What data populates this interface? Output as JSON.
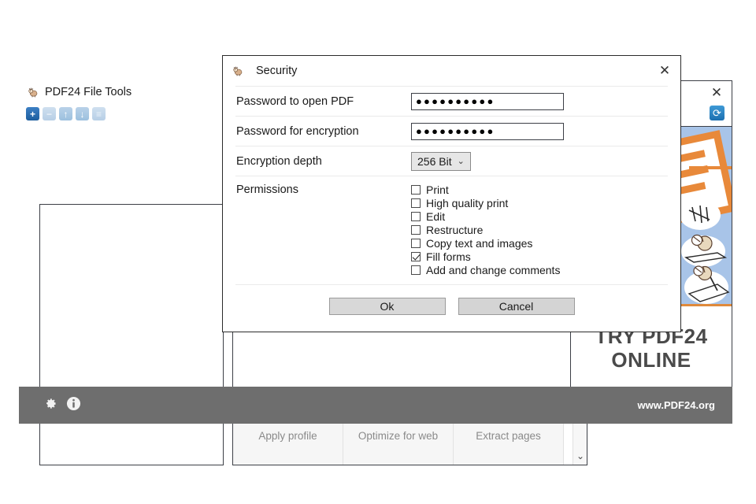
{
  "main_window": {
    "title": "PDF24 File Tools",
    "app_icon": "pdf24-sheep-icon",
    "toolbar": [
      {
        "name": "add-files-button",
        "glyph": "+",
        "state": "enabled"
      },
      {
        "name": "remove-files-button",
        "glyph": "−",
        "state": "disabled"
      },
      {
        "name": "move-up-button",
        "glyph": "↑",
        "state": "disabled"
      },
      {
        "name": "move-down-button",
        "glyph": "↓",
        "state": "disabled"
      },
      {
        "name": "sort-list-button",
        "glyph": "≡",
        "state": "disabled"
      }
    ],
    "file_list": {
      "items": [],
      "empty": true
    },
    "tools": [
      {
        "label": "Apply profile",
        "icon": "sliders-icon"
      },
      {
        "label": "Optimize for web",
        "icon": "web-optimize-icon"
      },
      {
        "label": "Extract pages",
        "icon": "extract-pages-icon"
      }
    ],
    "scroll_down_glyph": "⌄"
  },
  "ad_panel": {
    "close_glyph": "✕",
    "refresh_glyph": "⟳",
    "footer_line1": "TRY PDF24",
    "footer_line2": "ONLINE"
  },
  "status_bar": {
    "settings_icon": "gear-icon",
    "info_icon": "info-icon",
    "url": "www.PDF24.org",
    "background": "#6e6e6e"
  },
  "dialog": {
    "title": "Security",
    "icon": "pdf24-sheep-icon",
    "close_glyph": "✕",
    "fields": [
      {
        "label": "Password to open PDF",
        "value": "●●●●●●●●●●",
        "placeholder": "",
        "type": "password"
      },
      {
        "label": "Password for encryption",
        "value": "●●●●●●●●●●",
        "placeholder": "",
        "type": "password"
      }
    ],
    "encryption": {
      "label": "Encryption depth",
      "selected": "256 Bit",
      "caret": "⌄"
    },
    "permissions": {
      "label": "Permissions",
      "items": [
        {
          "label": "Print",
          "checked": false
        },
        {
          "label": "High quality print",
          "checked": false
        },
        {
          "label": "Edit",
          "checked": false
        },
        {
          "label": "Restructure",
          "checked": false
        },
        {
          "label": "Copy text and images",
          "checked": false
        },
        {
          "label": "Fill forms",
          "checked": true
        },
        {
          "label": "Add and change comments",
          "checked": false
        }
      ]
    },
    "buttons": {
      "ok": "Ok",
      "cancel": "Cancel"
    }
  }
}
